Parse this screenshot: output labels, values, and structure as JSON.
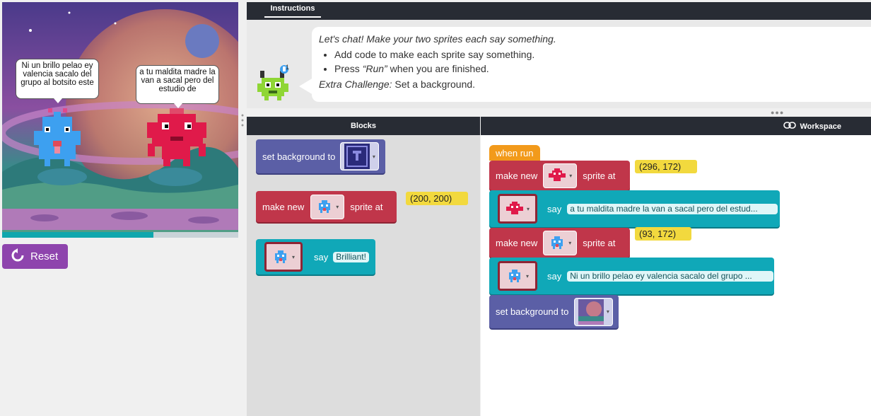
{
  "stage": {
    "sprite1_bubble": "Ni un brillo pelao ey valencia sacalo del grupo al botsito este",
    "sprite2_bubble": "a tu maldita madre la van a sacal pero del estudio de",
    "progress_fraction": 0.64
  },
  "controls": {
    "reset_label": "Reset"
  },
  "instructions": {
    "tab_label": "Instructions",
    "intro": "Let's chat! Make your two sprites each say something.",
    "bullets": [
      "Add code to make each sprite say something.",
      "Press “Run” when you are finished."
    ],
    "bullet2_pre": "Press ",
    "bullet2_run": "“Run”",
    "bullet2_post": " when you are finished.",
    "challenge_label": "Extra Challenge:",
    "challenge_text": " Set a background.",
    "hint_count": "1"
  },
  "toolbox": {
    "header": "Blocks",
    "set_background_label": "set background to",
    "make_new_label": "make new",
    "sprite_at_label": "sprite at",
    "make_new_coord": "(200, 200)",
    "say_label": "say",
    "say_text": "Brilliant!"
  },
  "workspace": {
    "header": "Workspace",
    "when_run": "when run",
    "block1_make": "make new",
    "block1_sprite_at": "sprite at",
    "block1_coord": "(296, 172)",
    "block2_say": "say",
    "block2_text": "a tu maldita madre la van a sacal pero del estud...",
    "block3_make": "make new",
    "block3_sprite_at": "sprite at",
    "block3_coord": "(93, 172)",
    "block4_say": "say",
    "block4_text": "Ni un brillo pelao ey valencia sacalo del grupo ...",
    "block5_label": "set background to"
  },
  "colors": {
    "purple_block": "#5b5fa6",
    "red_block": "#c0364a",
    "teal_block": "#10a8b8",
    "event_block": "#f29a1b",
    "coord_block": "#f2d93e",
    "reset_button": "#8e44ad",
    "header_dark": "#282c34"
  },
  "icons": {
    "reset": "rotate-ccw-icon",
    "workspace": "link-icon",
    "sprite_blue": "blue-alien-sprite-icon",
    "sprite_red": "red-alien-sprite-icon",
    "background_thumb": "space-background-thumbnail"
  }
}
